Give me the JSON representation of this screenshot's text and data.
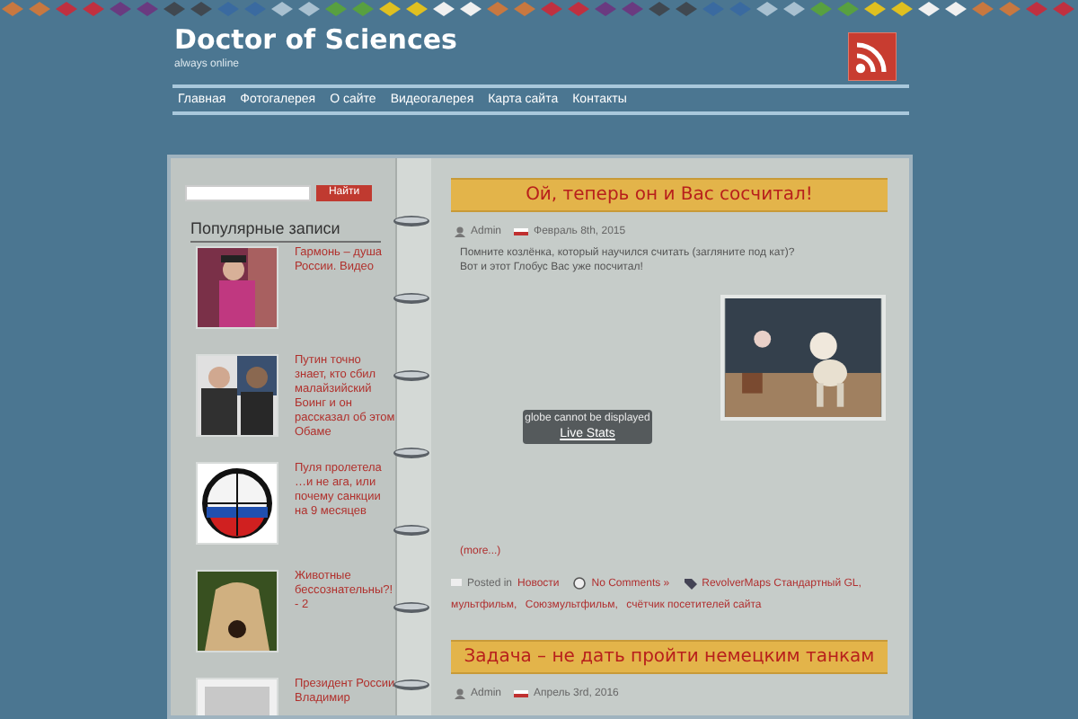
{
  "site": {
    "title": "Doctor of Sciences",
    "tagline": "always online"
  },
  "nav": [
    "Главная",
    "Фотогалерея",
    "О сайте",
    "Видеогалерея",
    "Карта сайта",
    "Контакты"
  ],
  "search": {
    "button": "Найти"
  },
  "sidebar": {
    "heading": "Популярные записи",
    "posts": [
      {
        "title": "Гармонь – душа России. Видео"
      },
      {
        "title": "Путин точно знает, кто сбил малайзийский Боинг и он рассказал об этом Обаме"
      },
      {
        "title": "Пуля пролетела …и не ага, или почему санкции на 9 месяцев"
      },
      {
        "title": "Животные бессознательны?! - 2"
      },
      {
        "title": "Президент России Владимир"
      }
    ]
  },
  "posts": [
    {
      "title": "Ой, теперь он и Вас сосчитал!",
      "author": "Admin",
      "date": "Февраль 8th, 2015",
      "body": [
        "Помните козлёнка, который научился считать (загляните под кат)?",
        "Вот и этот Глобус Вас уже посчитал!"
      ],
      "widget": {
        "text": "globe cannot be displayed",
        "link": "Live Stats"
      },
      "more": "(more...)",
      "footer": {
        "posted_in": "Posted in",
        "category": "Новости",
        "comments": "No Comments »",
        "tags": [
          "RevolverMaps Стандартный GL,",
          "мультфильм,",
          "Союзмультфильм,",
          "счётчик посетителей сайта"
        ]
      }
    },
    {
      "title": "Задача – не дать пройти немецким танкам",
      "author": "Admin",
      "date": "Апрель 3rd, 2016"
    }
  ]
}
